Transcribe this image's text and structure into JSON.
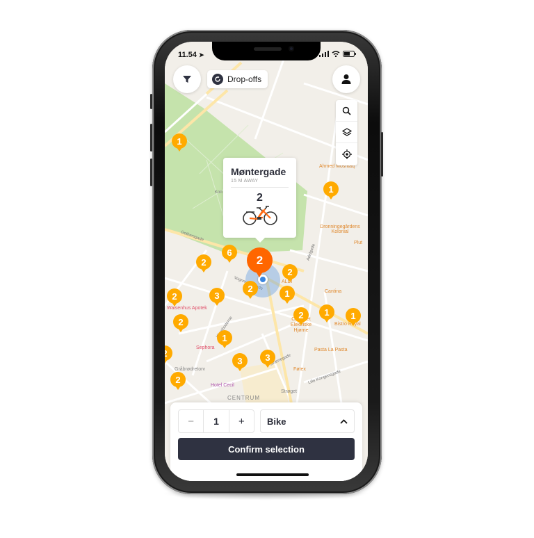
{
  "status_bar": {
    "time": "11.54"
  },
  "top_bar": {
    "filter_icon": "filter-icon",
    "dropoffs_label": "Drop-offs",
    "profile_icon": "user-icon"
  },
  "map_tools": [
    {
      "name": "search-icon"
    },
    {
      "name": "layers-icon"
    },
    {
      "name": "locate-icon"
    }
  ],
  "colors": {
    "marker": "#ffaa00",
    "marker_selected": "#ff6600",
    "primary_button": "#2f3241",
    "user_location": "#3a86e0",
    "park": "#bfe0a6"
  },
  "popup": {
    "title": "Møntergade",
    "distance": "15 M AWAY",
    "count": "2",
    "vehicle_icon": "bike-icon"
  },
  "markers": [
    {
      "count": "1"
    },
    {
      "count": "1"
    },
    {
      "count": "2"
    },
    {
      "count": "6"
    },
    {
      "count": "2"
    },
    {
      "count": "2"
    },
    {
      "count": "2"
    },
    {
      "count": "1"
    },
    {
      "count": "2"
    },
    {
      "count": "3"
    },
    {
      "count": "2"
    },
    {
      "count": "1"
    },
    {
      "count": "1"
    },
    {
      "count": "2"
    },
    {
      "count": "1"
    },
    {
      "count": "3"
    },
    {
      "count": "3"
    },
    {
      "count": "2"
    }
  ],
  "map_labels": {
    "pois": [
      "Ahmed Moshtaq",
      "Dronningegårdens Kolonial",
      "Plut",
      "Cantina",
      "ALDI",
      "Waisenhus Apotek",
      "Cafe Det Elektriske Hjørne",
      "Bistro Royal",
      "Sephora",
      "Pasta La Pasta",
      "Gråbrødretorv",
      "Føtex",
      "Hotel Cecil",
      "Strøget"
    ],
    "streets": [
      "Gothersgade",
      "Vognmagergade",
      "Sværtegade",
      "Lille Kongensgade",
      "Adelgade",
      "Klareboderne"
    ],
    "district": "CENTRUM",
    "park_label": "Kon"
  },
  "bottom_sheet": {
    "decrement_label": "−",
    "quantity": "1",
    "increment_label": "+",
    "vehicle_type": "Bike",
    "confirm_label": "Confirm selection"
  }
}
